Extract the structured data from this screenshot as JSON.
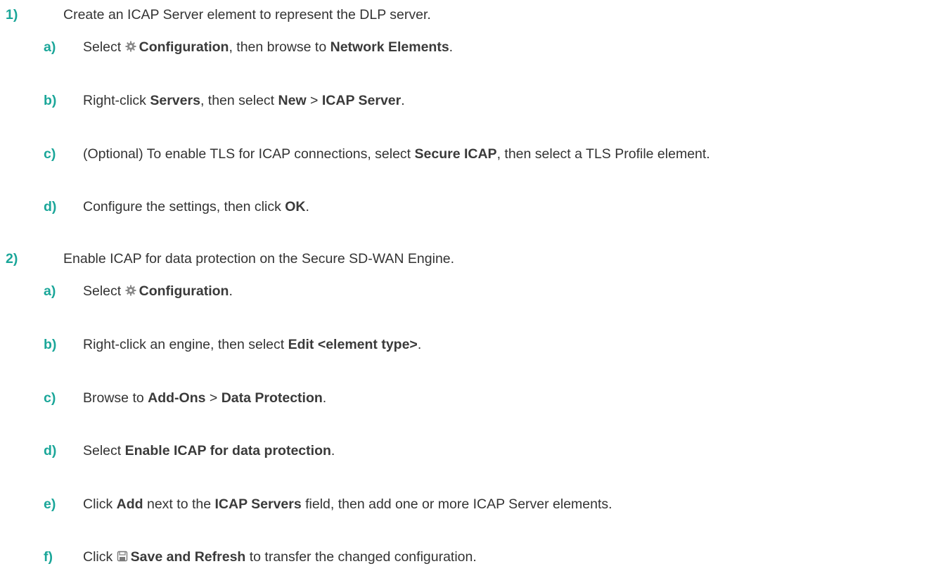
{
  "accent_color": "#1aa699",
  "steps": [
    {
      "num": "1)",
      "text": "Create an ICAP Server element to represent the DLP server.",
      "substeps": [
        {
          "num": "a)",
          "p1": "Select ",
          "icon": "gear-icon",
          "b1": "Configuration",
          "p2": ", then browse to ",
          "b2": "Network Elements",
          "p3": "."
        },
        {
          "num": "b)",
          "p1": "Right-click ",
          "b1": "Servers",
          "p2": ", then select ",
          "b2": "New",
          "p3": " > ",
          "b3": "ICAP Server",
          "p4": "."
        },
        {
          "num": "c)",
          "p1": "(Optional) To enable TLS for ICAP connections, select ",
          "b1": "Secure ICAP",
          "p2": ", then select a TLS Profile element."
        },
        {
          "num": "d)",
          "p1": "Configure the settings, then click ",
          "b1": "OK",
          "p2": "."
        }
      ]
    },
    {
      "num": "2)",
      "text": "Enable ICAP for data protection on the Secure SD-WAN Engine.",
      "substeps": [
        {
          "num": "a)",
          "p1": "Select ",
          "icon": "gear-icon",
          "b1": "Configuration",
          "p2": "."
        },
        {
          "num": "b)",
          "p1": "Right-click an engine, then select ",
          "b1": "Edit <element type>",
          "p2": "."
        },
        {
          "num": "c)",
          "p1": "Browse to ",
          "b1": "Add-Ons",
          "p2": " > ",
          "b2": "Data Protection",
          "p3": "."
        },
        {
          "num": "d)",
          "p1": "Select ",
          "b1": "Enable ICAP for data protection",
          "p2": "."
        },
        {
          "num": "e)",
          "p1": "Click ",
          "b1": "Add",
          "p2": " next to the ",
          "b2": "ICAP Servers",
          "p3": " field, then add one or more ICAP Server elements."
        },
        {
          "num": "f)",
          "p1": "Click ",
          "icon": "save-icon",
          "b1": "Save and Refresh",
          "p2": " to transfer the changed configuration."
        }
      ]
    }
  ]
}
